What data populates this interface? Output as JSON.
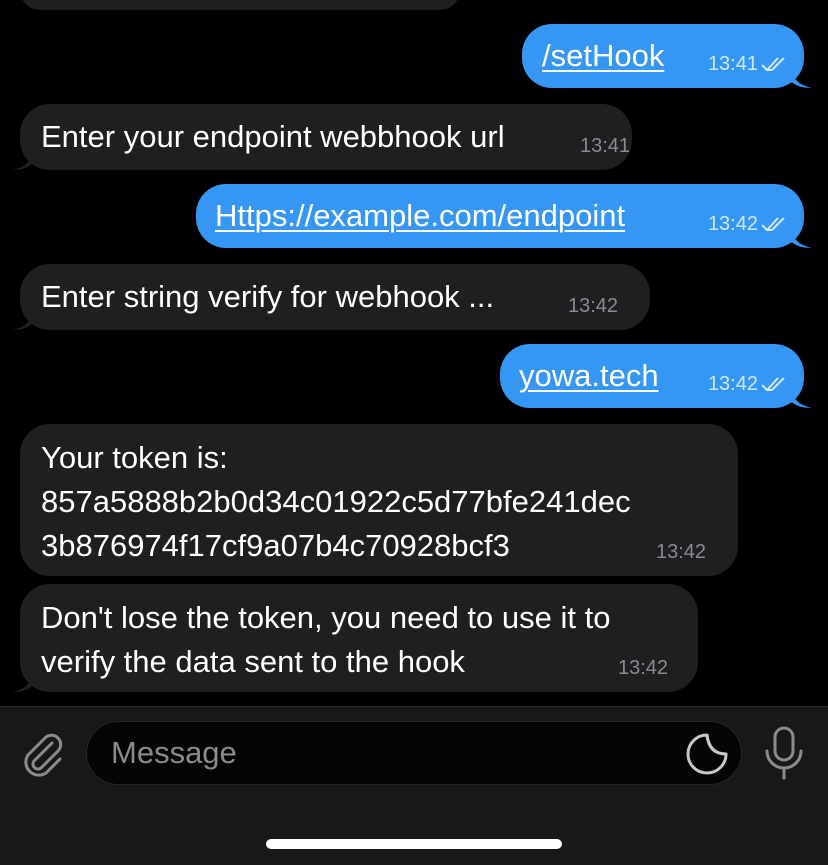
{
  "messages": [
    {
      "direction": "out",
      "text": "/setHook",
      "time": "13:41",
      "read": true
    },
    {
      "direction": "in",
      "text": "Enter your endpoint webbhook url",
      "time": "13:41"
    },
    {
      "direction": "out",
      "text": "Https://example.com/endpoint",
      "time": "13:42",
      "read": true
    },
    {
      "direction": "in",
      "text": "Enter string verify for webhook ...",
      "time": "13:42"
    },
    {
      "direction": "out",
      "text": "yowa.tech",
      "time": "13:42",
      "read": true
    },
    {
      "direction": "in",
      "lines": [
        "Your token is:",
        "857a5888b2b0d34c01922c5d77bfe241dec",
        "3b876974f17cf9a07b4c70928bcf3"
      ],
      "time": "13:42"
    },
    {
      "direction": "in",
      "lines": [
        "Don't lose the token, you need to use it to",
        "verify the data sent to the hook"
      ],
      "time": "13:42"
    }
  ],
  "composer": {
    "placeholder": "Message",
    "attach_icon": "paperclip-icon",
    "sticker_icon": "sticker-icon",
    "mic_icon": "microphone-icon"
  },
  "colors": {
    "background": "#000000",
    "incoming_bubble": "#1f1f21",
    "outgoing_bubble": "#3596f3",
    "composer_bar": "#181818"
  }
}
